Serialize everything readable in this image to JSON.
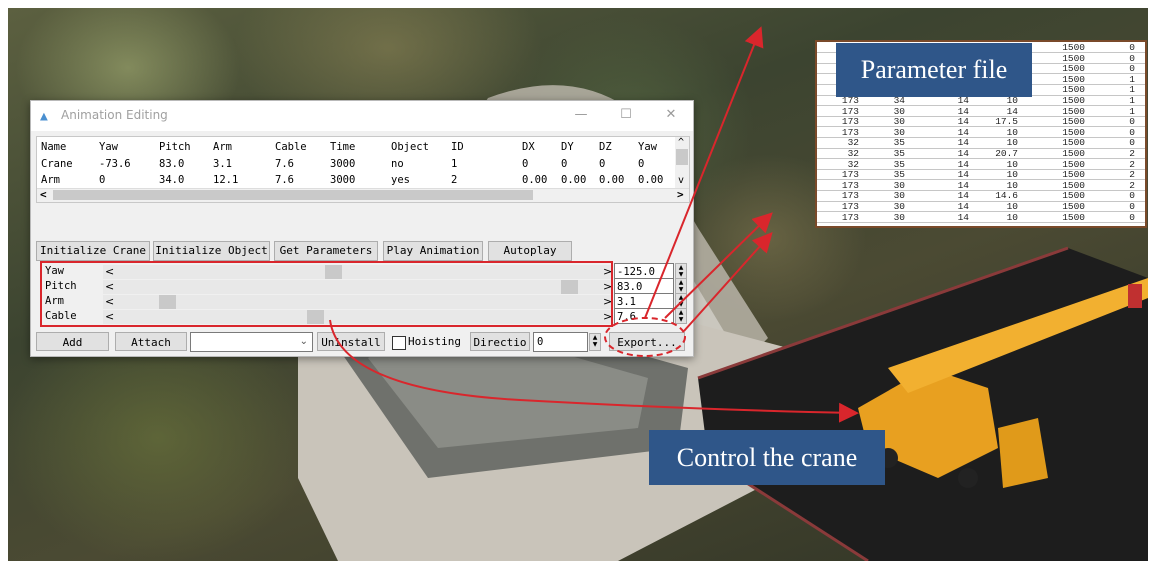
{
  "window": {
    "title": "Animation Editing",
    "minimize_glyph": "—",
    "maximize_glyph": "☐",
    "close_glyph": "✕",
    "icon": "app-icon"
  },
  "grid": {
    "columns": [
      "Name",
      "Yaw",
      "Pitch",
      "Arm",
      "Cable",
      "Time",
      "Object",
      "ID",
      "DX",
      "DY",
      "DZ",
      "Yaw"
    ],
    "rows": [
      [
        "Crane",
        "-73.6",
        "83.0",
        "3.1",
        "7.6",
        "3000",
        "no",
        "1",
        "0",
        "0",
        "0",
        "0"
      ],
      [
        "Arm",
        "0",
        "34.0",
        "12.1",
        "7.6",
        "3000",
        "yes",
        "2",
        "0.00",
        "0.00",
        "0.00",
        "0.00"
      ]
    ],
    "scroll_left": "<",
    "scroll_right": ">",
    "scroll_up": "^",
    "scroll_down": "v"
  },
  "toolbar": {
    "initialize_crane": "Initialize Crane",
    "initialize_object": "Initialize Object",
    "get_parameters": "Get Parameters",
    "play_animation": "Play Animation",
    "autoplay": "Autoplay"
  },
  "sliders": [
    {
      "label": "Yaw",
      "value": "-125.0",
      "level": 0.45
    },
    {
      "label": "Pitch",
      "value": "83.0",
      "level": 0.96
    },
    {
      "label": "Arm",
      "value": "3.1",
      "level": 0.09
    },
    {
      "label": "Cable",
      "value": "7.6",
      "level": 0.41
    }
  ],
  "slider_arrows": {
    "left": "<",
    "right": ">"
  },
  "bottom": {
    "add": "Add",
    "attach": "Attach",
    "uninstall": "Uninstall",
    "hoisting": "Hoisting",
    "direction": "Directio",
    "direction_value": "0",
    "export": "Export..."
  },
  "parameter_file": {
    "banner": "Parameter file",
    "rows": [
      [
        "",
        "",
        "",
        "",
        "1500",
        "0"
      ],
      [
        "",
        "",
        "",
        "",
        "1500",
        "0"
      ],
      [
        "",
        "",
        "",
        "",
        "1500",
        "0"
      ],
      [
        "",
        "",
        "",
        "",
        "1500",
        "1"
      ],
      [
        "",
        "",
        "",
        "",
        "1500",
        "1"
      ],
      [
        "173",
        "34",
        "14",
        "10",
        "1500",
        "1"
      ],
      [
        "173",
        "30",
        "14",
        "14",
        "1500",
        "1"
      ],
      [
        "173",
        "30",
        "14",
        "17.5",
        "1500",
        "0"
      ],
      [
        "173",
        "30",
        "14",
        "10",
        "1500",
        "0"
      ],
      [
        "32",
        "35",
        "14",
        "10",
        "1500",
        "0"
      ],
      [
        "32",
        "35",
        "14",
        "20.7",
        "1500",
        "2"
      ],
      [
        "32",
        "35",
        "14",
        "10",
        "1500",
        "2"
      ],
      [
        "173",
        "35",
        "14",
        "10",
        "1500",
        "2"
      ],
      [
        "173",
        "30",
        "14",
        "10",
        "1500",
        "2"
      ],
      [
        "173",
        "30",
        "14",
        "14.6",
        "1500",
        "0"
      ],
      [
        "173",
        "30",
        "14",
        "10",
        "1500",
        "0"
      ],
      [
        "173",
        "30",
        "14",
        "10",
        "1500",
        "0"
      ]
    ]
  },
  "control_banner": "Control the crane",
  "colors": {
    "annotation_red": "#d9262c",
    "banner_blue": "#2f5689",
    "crane_orange": "#e8a020"
  }
}
